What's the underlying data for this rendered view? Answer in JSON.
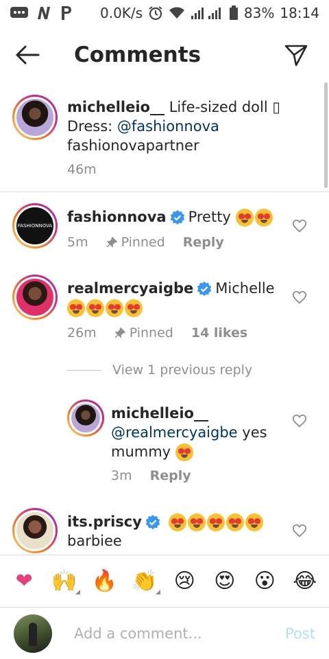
{
  "status_bar": {
    "speed": "0.0K/s",
    "battery": "83%",
    "time": "18:14"
  },
  "header": {
    "title": "Comments"
  },
  "caption": {
    "username": "michelleio__",
    "text_line1": "Life-sized doll ▯",
    "text_dress": "Dress: ",
    "mention": "@fashionnova",
    "text_line3": "fashionovapartner",
    "time": "46m"
  },
  "comments": [
    {
      "username": "fashionnova",
      "text": "Pretty",
      "time": "5m",
      "pinned": "Pinned",
      "reply": "Reply",
      "avatar_text": "FASHIONNOVA"
    },
    {
      "username": "realmercyaigbe",
      "text": "Michelle",
      "time": "26m",
      "pinned": "Pinned",
      "likes": "14 likes"
    },
    {
      "username": "its.priscy",
      "text": "barbiee"
    }
  ],
  "view_replies": "View 1 previous reply",
  "reply": {
    "username": "michelleio__",
    "mention": "@realmercyaigbe",
    "text_after": " yes",
    "text_line3": "mummy",
    "time": "3m",
    "reply_label": "Reply"
  },
  "emoji_bar": [
    "❤",
    "🙌",
    "🔥",
    "👏",
    "😢",
    "😍",
    "😮",
    "😂"
  ],
  "composer": {
    "placeholder": "Add a comment...",
    "post_label": "Post"
  },
  "colors": {
    "mention": "#003569",
    "post": "#b2dffc",
    "verified": "#3897f0",
    "meta": "#8e8e8e"
  }
}
